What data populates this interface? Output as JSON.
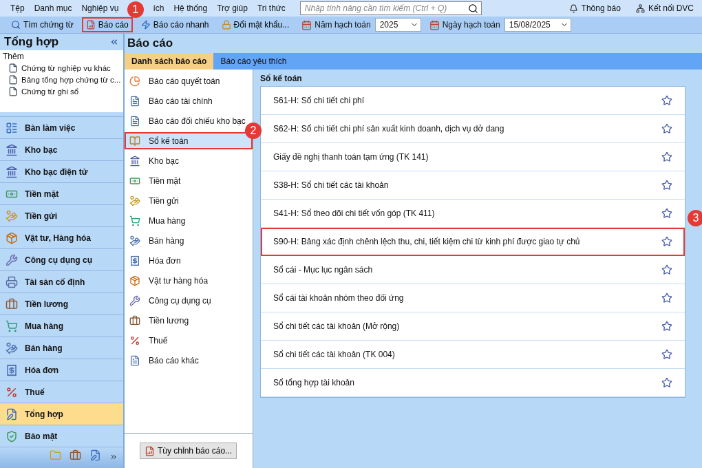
{
  "menu": [
    {
      "label": "Tệp"
    },
    {
      "label": "Danh mục"
    },
    {
      "label": "Nghiệp vụ"
    },
    {
      "label": "ích"
    },
    {
      "label": "Hệ thống"
    },
    {
      "label": "Trợ giúp"
    },
    {
      "label": "Tri thức"
    }
  ],
  "search": {
    "placeholder": "Nhập tính năng cần tìm kiếm (Ctrl + Q)"
  },
  "top_right": [
    {
      "label": "Thông báo"
    },
    {
      "label": "Kết nối DVC"
    }
  ],
  "toolbar": [
    {
      "label": "Tìm chứng từ",
      "highlighted": false
    },
    {
      "label": "Báo cáo",
      "highlighted": true,
      "callout": "1"
    },
    {
      "label": "Báo cáo nhanh",
      "highlighted": false
    },
    {
      "label": "Đổi mật khẩu...",
      "highlighted": false
    }
  ],
  "year": {
    "label": "Năm hạch toán",
    "value": "2025"
  },
  "date": {
    "label": "Ngày hạch toán",
    "value": "15/08/2025"
  },
  "sidebar": {
    "title": "Tổng hợp",
    "more_label": "Thêm",
    "shortcuts": [
      {
        "label": "Chứng từ nghiệp vụ khác"
      },
      {
        "label": "Bảng tổng hợp chứng từ c..."
      },
      {
        "label": "Chứng từ ghi sổ"
      }
    ],
    "items": [
      {
        "label": "Bàn làm việc",
        "selected": false
      },
      {
        "label": "Kho bạc",
        "selected": false
      },
      {
        "label": "Kho bạc điện tử",
        "selected": false
      },
      {
        "label": "Tiền mặt",
        "selected": false
      },
      {
        "label": "Tiền gửi",
        "selected": false
      },
      {
        "label": "Vật tư, Hàng hóa",
        "selected": false
      },
      {
        "label": "Công cụ dụng cụ",
        "selected": false
      },
      {
        "label": "Tài sản cố định",
        "selected": false
      },
      {
        "label": "Tiền lương",
        "selected": false
      },
      {
        "label": "Mua hàng",
        "selected": false
      },
      {
        "label": "Bán hàng",
        "selected": false
      },
      {
        "label": "Hóa đơn",
        "selected": false
      },
      {
        "label": "Thuế",
        "selected": false
      },
      {
        "label": "Tổng hợp",
        "selected": true
      },
      {
        "label": "Bảo mật",
        "selected": false
      }
    ]
  },
  "report_panel": {
    "title": "Báo cáo",
    "tabs": [
      {
        "label": "Danh sách báo cáo",
        "selected": true
      },
      {
        "label": "Báo cáo yêu thích",
        "selected": false
      }
    ],
    "categories": [
      {
        "label": "Báo cáo quyết toán",
        "selected": false
      },
      {
        "label": "Báo cáo tài chính",
        "selected": false
      },
      {
        "label": "Báo cáo đối chiếu kho bạc",
        "selected": false
      },
      {
        "label": "Sổ kế toán",
        "selected": true,
        "callout": "2"
      },
      {
        "label": "Kho bạc",
        "selected": false
      },
      {
        "label": "Tiền mặt",
        "selected": false
      },
      {
        "label": "Tiền gửi",
        "selected": false
      },
      {
        "label": "Mua hàng",
        "selected": false
      },
      {
        "label": "Bán hàng",
        "selected": false
      },
      {
        "label": "Hóa đơn",
        "selected": false
      },
      {
        "label": "Vật tư hàng hóa",
        "selected": false
      },
      {
        "label": "Công cụ dụng cụ",
        "selected": false
      },
      {
        "label": "Tiền lương",
        "selected": false
      },
      {
        "label": "Thuế",
        "selected": false
      },
      {
        "label": "Báo cáo khác",
        "selected": false
      }
    ],
    "customize_button": "Tùy chỉnh báo cáo...",
    "section_title": "Sổ kế toán",
    "reports": [
      {
        "label": "S61-H: Sổ chi tiết chi phí",
        "favorite": false
      },
      {
        "label": "S62-H: Sổ chi tiết chi phí sản xuất kinh doanh, dịch vụ dở dang",
        "favorite": false
      },
      {
        "label": "Giấy đề nghị thanh toán tạm ứng (TK 141)",
        "favorite": false
      },
      {
        "label": "S38-H: Sổ chi tiết các tài khoản",
        "favorite": false
      },
      {
        "label": "S41-H: Sổ theo dõi chi tiết vốn góp (TK 411)",
        "favorite": false
      },
      {
        "label": "S90-H: Bảng xác định chênh lệch thu, chi, tiết kiệm chi từ kinh phí được giao tự chủ",
        "favorite": false,
        "callout": "3"
      },
      {
        "label": "Sổ cái - Mục lục ngân sách",
        "favorite": false
      },
      {
        "label": "Sổ cái tài khoản nhóm theo đối ứng",
        "favorite": false
      },
      {
        "label": "Sổ chi tiết các tài khoản (Mở rộng)",
        "favorite": false
      },
      {
        "label": "Sổ chi tiết các tài khoản (TK 004)",
        "favorite": false
      },
      {
        "label": "Sổ tổng hợp tài khoản",
        "favorite": false
      }
    ]
  }
}
